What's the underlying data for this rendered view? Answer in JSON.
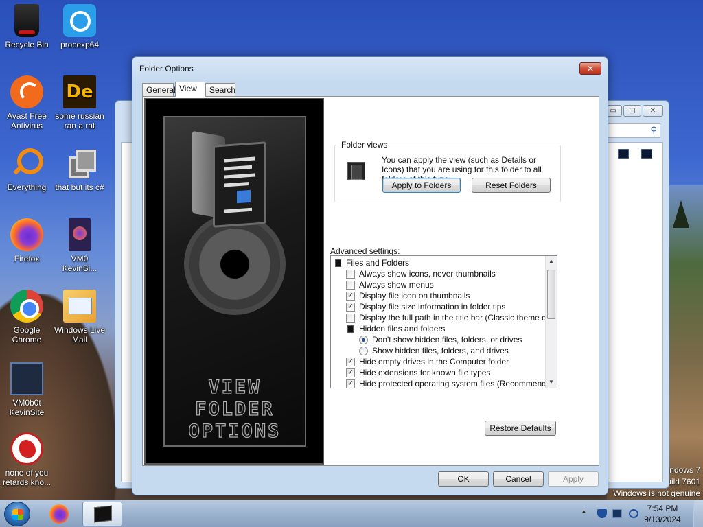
{
  "desktop": {
    "icons": [
      {
        "label": "Recycle Bin",
        "icon": "recycle-bin-icon"
      },
      {
        "label": "procexp64",
        "icon": "process-explorer-icon"
      },
      {
        "label": "Avast Free Antivirus",
        "icon": "avast-icon"
      },
      {
        "label": "some russian ran a rat",
        "icon": "de-app-icon"
      },
      {
        "label": "Everything",
        "icon": "everything-search-icon"
      },
      {
        "label": "that but its c#",
        "icon": "copy-icon"
      },
      {
        "label": "Firefox",
        "icon": "firefox-icon"
      },
      {
        "label": "VM0 KevinSi...",
        "icon": "firefox-document-icon"
      },
      {
        "label": "Google Chrome",
        "icon": "chrome-icon"
      },
      {
        "label": "Windows Live Mail",
        "icon": "windows-live-mail-icon"
      },
      {
        "label": "VM0b0t KevinSite",
        "icon": "vm-shortcut-icon"
      },
      {
        "label": "none of you retards kno...",
        "icon": "dragon-icon"
      }
    ],
    "watermark": {
      "line1": "ndows 7",
      "line2": "uild 7601",
      "line3": "Windows is not genuine"
    }
  },
  "dialog": {
    "title": "Folder Options",
    "close_label": "✕",
    "tabs": [
      {
        "label": "General",
        "active": false
      },
      {
        "label": "View",
        "active": true
      },
      {
        "label": "Search",
        "active": false
      }
    ],
    "art_text": [
      "VIEW",
      "FOLDER",
      "OPTIONS"
    ],
    "folder_views": {
      "legend": "Folder views",
      "description": "You can apply the view (such as Details or Icons) that you are using for this folder to all folders of this type.",
      "apply_label": "Apply to Folders",
      "reset_label": "Reset Folders"
    },
    "advanced": {
      "label": "Advanced settings:",
      "items": [
        {
          "text": "Files and Folders",
          "kind": "folder",
          "level": 0
        },
        {
          "text": "Always show icons, never thumbnails",
          "kind": "checkbox",
          "checked": false,
          "level": 1
        },
        {
          "text": "Always show menus",
          "kind": "checkbox",
          "checked": false,
          "level": 1
        },
        {
          "text": "Display file icon on thumbnails",
          "kind": "checkbox",
          "checked": true,
          "level": 1
        },
        {
          "text": "Display file size information in folder tips",
          "kind": "checkbox",
          "checked": true,
          "level": 1
        },
        {
          "text": "Display the full path in the title bar (Classic theme only)",
          "kind": "checkbox",
          "checked": false,
          "level": 1
        },
        {
          "text": "Hidden files and folders",
          "kind": "folder",
          "level": 1
        },
        {
          "text": "Don't show hidden files, folders, or drives",
          "kind": "radio",
          "checked": true,
          "level": 2
        },
        {
          "text": "Show hidden files, folders, and drives",
          "kind": "radio",
          "checked": false,
          "level": 2
        },
        {
          "text": "Hide empty drives in the Computer folder",
          "kind": "checkbox",
          "checked": true,
          "level": 1
        },
        {
          "text": "Hide extensions for known file types",
          "kind": "checkbox",
          "checked": true,
          "level": 1
        },
        {
          "text": "Hide protected operating system files (Recommended)",
          "kind": "checkbox",
          "checked": true,
          "level": 1
        }
      ]
    },
    "restore_label": "Restore Defaults",
    "ok_label": "OK",
    "cancel_label": "Cancel",
    "apply_label": "Apply"
  },
  "background_window": {
    "minimize": "▭",
    "maximize": "▢",
    "close": "✕",
    "search_icon": "⚲"
  },
  "taskbar": {
    "clock_time": "7:54 PM",
    "clock_date": "9/13/2024",
    "tray_arrow": "▲"
  }
}
